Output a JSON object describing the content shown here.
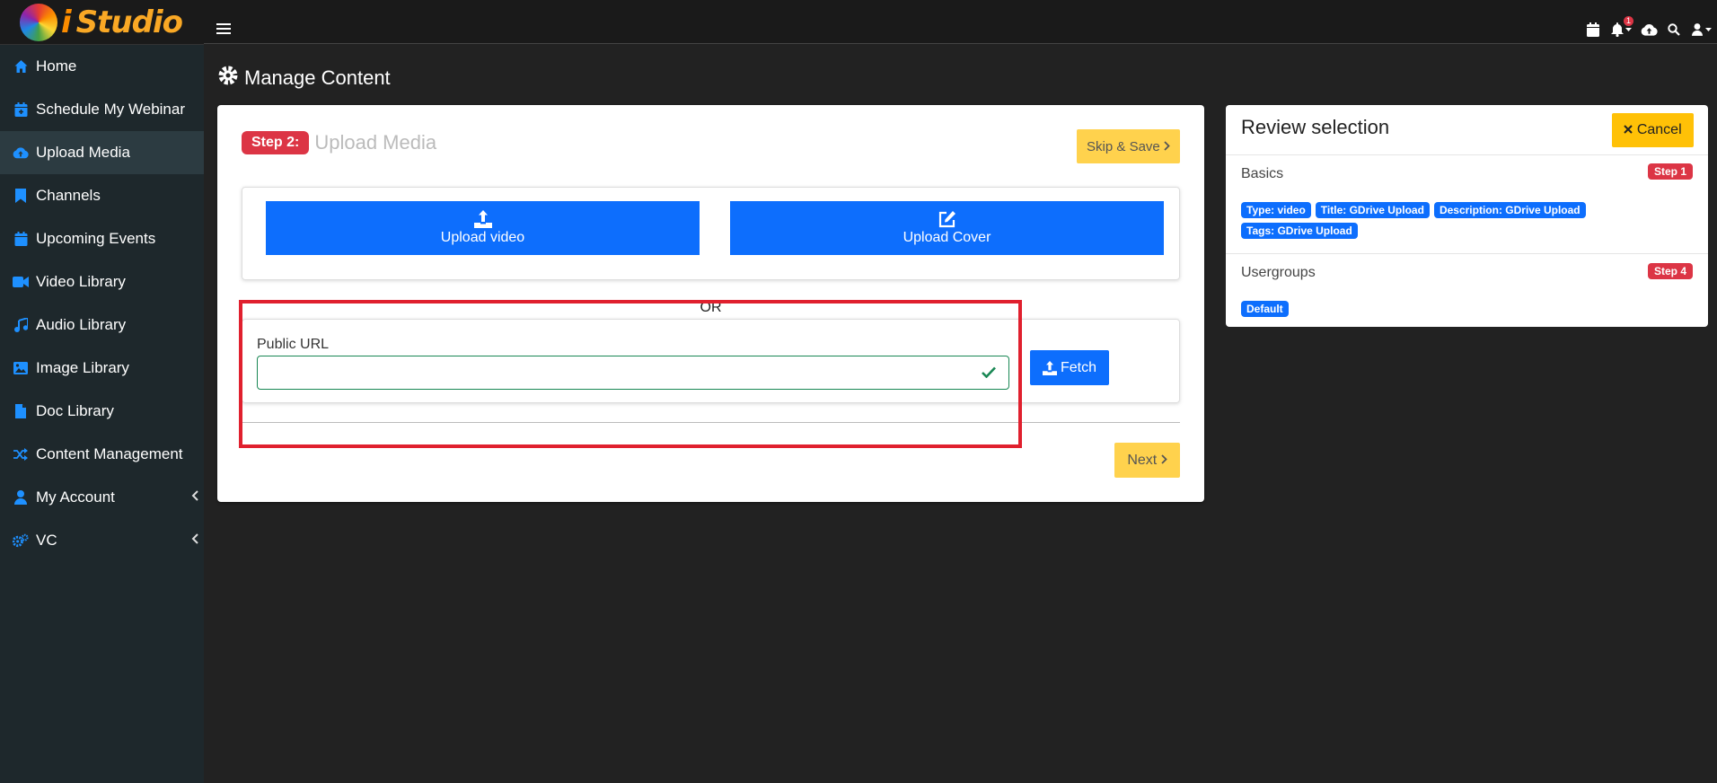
{
  "brand": {
    "name": "Studio",
    "letter": "i"
  },
  "sidebar": {
    "items": [
      {
        "label": "Home",
        "icon": "home-icon"
      },
      {
        "label": "Schedule My Webinar",
        "icon": "calendar-plus-icon"
      },
      {
        "label": "Upload Media",
        "icon": "cloud-upload-icon",
        "active": true
      },
      {
        "label": "Channels",
        "icon": "bookmark-icon"
      },
      {
        "label": "Upcoming Events",
        "icon": "calendar-icon"
      },
      {
        "label": "Video Library",
        "icon": "video-icon"
      },
      {
        "label": "Audio Library",
        "icon": "music-icon"
      },
      {
        "label": "Image Library",
        "icon": "image-icon"
      },
      {
        "label": "Doc Library",
        "icon": "file-icon"
      },
      {
        "label": "Content Management",
        "icon": "shuffle-icon"
      },
      {
        "label": "My Account",
        "icon": "user-icon",
        "expandable": true
      },
      {
        "label": "VC",
        "icon": "cogs-icon",
        "expandable": true
      }
    ]
  },
  "topbar": {
    "notification_count": "1"
  },
  "page": {
    "title": "Manage Content"
  },
  "step": {
    "badge": "Step 2:",
    "title": "Upload Media",
    "skip_label": "Skip & Save",
    "upload_video_label": "Upload video",
    "upload_cover_label": "Upload Cover",
    "or_text": "OR",
    "url_label": "Public URL",
    "url_value": "",
    "fetch_label": "Fetch",
    "next_label": "Next"
  },
  "review": {
    "title": "Review selection",
    "cancel_label": "Cancel",
    "sections": [
      {
        "title": "Basics",
        "step": "Step 1",
        "tags": [
          "Type: video",
          "Title: GDrive Upload",
          "Description: GDrive Upload",
          "Tags: GDrive Upload"
        ]
      },
      {
        "title": "Usergroups",
        "step": "Step 4",
        "tags": [
          "Default"
        ]
      }
    ]
  },
  "colors": {
    "primary": "#0d6efd",
    "danger": "#dc3545",
    "warning": "#ffc107",
    "success": "#198754",
    "highlight": "#e0202e"
  }
}
